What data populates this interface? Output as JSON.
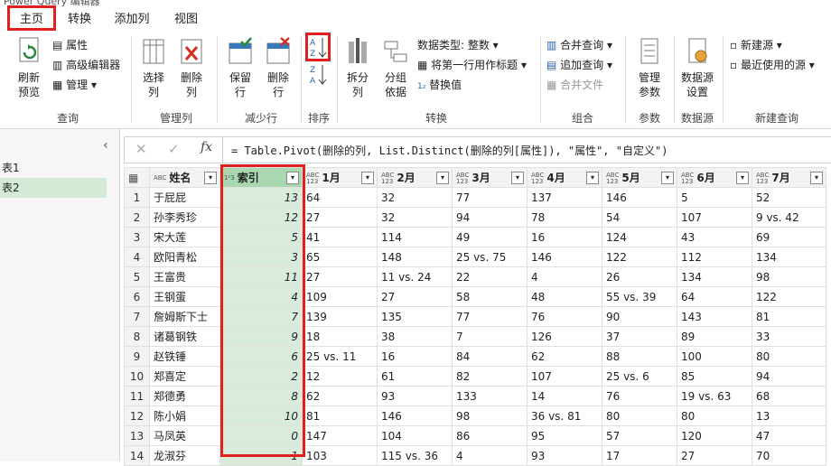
{
  "title_bar": {
    "text": "Power Query 编辑器"
  },
  "tabs": [
    "主页",
    "转换",
    "添加列",
    "视图"
  ],
  "ribbon": {
    "refresh": "刷新\n预览",
    "properties": "属性",
    "advanced_editor": "高级编辑器",
    "manage": "管理",
    "choose_cols": "选择\n列",
    "remove_cols": "删除\n列",
    "keep_rows": "保留\n行",
    "remove_rows": "删除\n行",
    "split_col": "拆分\n列",
    "group_by": "分组\n依据",
    "data_type": "数据类型: 整数",
    "first_row_header": "将第一行用作标题",
    "replace_values": "替换值",
    "merge_queries": "合并查询",
    "append_queries": "追加查询",
    "combine_files": "合并文件",
    "manage_params": "管理\n参数",
    "datasource_settings": "数据源\n设置",
    "new_source": "新建源",
    "recent_sources": "最近使用的源",
    "groups": [
      "查询",
      "管理列",
      "减少行",
      "排序",
      "转换",
      "组合",
      "参数",
      "数据源",
      "新建查询"
    ]
  },
  "queries": {
    "items": [
      "表1",
      "表2"
    ]
  },
  "formula": {
    "text": "= Table.Pivot(删除的列, List.Distinct(删除的列[属性]), \"属性\", \"自定义\")"
  },
  "table": {
    "columns": [
      "姓名",
      "索引",
      "1月",
      "2月",
      "3月",
      "4月",
      "5月",
      "6月",
      "7月"
    ],
    "type_badges": [
      "ABC",
      "1²3",
      "ABC\n123",
      "ABC\n123",
      "ABC\n123",
      "ABC\n123",
      "ABC\n123",
      "ABC\n123",
      "ABC\n123"
    ],
    "rows": [
      [
        "于屁屁",
        "13",
        "64",
        "32",
        "77",
        "137",
        "146",
        "5",
        "52"
      ],
      [
        "孙李秀珍",
        "12",
        "27",
        "32",
        "94",
        "78",
        "54",
        "107",
        "9 vs. 42"
      ],
      [
        "宋大莲",
        "5",
        "41",
        "114",
        "49",
        "16",
        "124",
        "43",
        "69"
      ],
      [
        "欧阳青松",
        "3",
        "65",
        "148",
        "25 vs. 75",
        "146",
        "122",
        "112",
        "134"
      ],
      [
        "王富贵",
        "11",
        "27",
        "11 vs. 24",
        "22",
        "4",
        "26",
        "134",
        "98"
      ],
      [
        "王钢蛋",
        "4",
        "109",
        "27",
        "58",
        "48",
        "55 vs. 39",
        "64",
        "122"
      ],
      [
        "詹姆斯下士",
        "7",
        "139",
        "135",
        "77",
        "76",
        "90",
        "143",
        "81"
      ],
      [
        "诸葛钢铁",
        "9",
        "18",
        "38",
        "7",
        "126",
        "37",
        "89",
        "33"
      ],
      [
        "赵铁锤",
        "6",
        "25 vs. 11",
        "16",
        "84",
        "62",
        "88",
        "100",
        "80"
      ],
      [
        "郑喜定",
        "2",
        "12",
        "61",
        "82",
        "107",
        "25 vs. 6",
        "85",
        "94"
      ],
      [
        "郑德勇",
        "8",
        "62",
        "93",
        "133",
        "14",
        "76",
        "19 vs. 63",
        "68"
      ],
      [
        "陈小娟",
        "10",
        "81",
        "146",
        "98",
        "36 vs. 81",
        "80",
        "80",
        "13"
      ],
      [
        "马凤英",
        "0",
        "147",
        "104",
        "86",
        "95",
        "57",
        "120",
        "47"
      ],
      [
        "龙淑芬",
        "1",
        "103",
        "115 vs. 36",
        "4",
        "93",
        "17",
        "27",
        "70"
      ]
    ]
  }
}
